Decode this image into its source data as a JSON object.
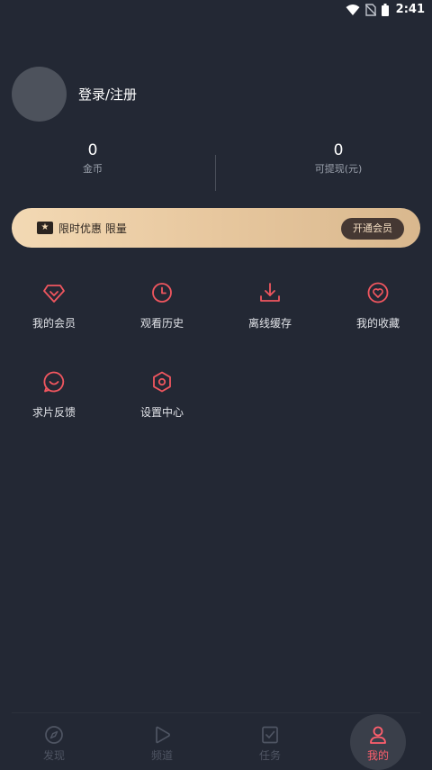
{
  "status_bar": {
    "time": "2:41"
  },
  "profile": {
    "login_label": "登录/注册"
  },
  "stats": {
    "coins": {
      "value": "0",
      "label": "金币"
    },
    "withdrawable": {
      "value": "0",
      "label": "可提现(元)"
    }
  },
  "vip_banner": {
    "text": "限时优惠 限量",
    "button_label": "开通会员",
    "icon": "ticket-star-icon"
  },
  "grid": [
    {
      "label": "我的会员",
      "icon": "diamond-icon"
    },
    {
      "label": "观看历史",
      "icon": "clock-icon"
    },
    {
      "label": "离线缓存",
      "icon": "download-icon"
    },
    {
      "label": "我的收藏",
      "icon": "heart-icon"
    },
    {
      "label": "求片反馈",
      "icon": "chat-smile-icon"
    },
    {
      "label": "设置中心",
      "icon": "hexagon-settings-icon"
    }
  ],
  "bottom_nav": [
    {
      "label": "发现",
      "icon": "compass-icon"
    },
    {
      "label": "频道",
      "icon": "play-icon"
    },
    {
      "label": "任务",
      "icon": "task-check-icon"
    },
    {
      "label": "我的",
      "icon": "user-icon",
      "active": true
    }
  ],
  "colors": {
    "background": "#232834",
    "accent": "#ff5f6d",
    "icon_red": "#f0565f",
    "vip_gold": "#f3d9b4",
    "nav_inactive": "#4f5563"
  }
}
